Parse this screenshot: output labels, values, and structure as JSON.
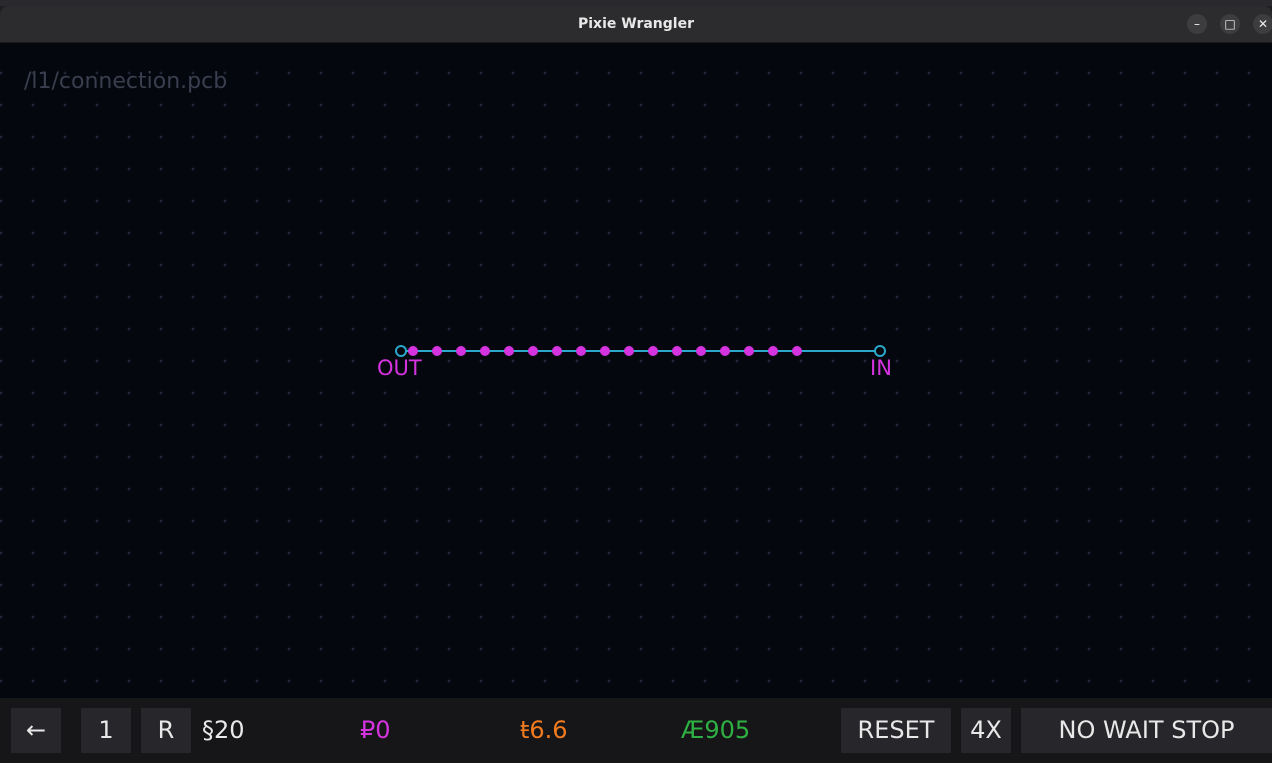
{
  "window": {
    "title": "Pixie Wrangler",
    "minimize_glyph": "–",
    "maximize_glyph": "□",
    "close_glyph": "✕"
  },
  "canvas": {
    "file_path": "/l1/connection.pcb",
    "out_label": "OUT",
    "in_label": "IN",
    "trace_color": "#2aa7c9",
    "pixie_color": "#d633e0",
    "pixie_count": 17
  },
  "toolbar": {
    "back_glyph": "←",
    "level_button": "1",
    "reset_r_button": "R",
    "segments_stat": "§20",
    "pixie_stat": "₽0",
    "time_stat": "ŧ6.6",
    "score_stat": "Æ905",
    "reset_button": "RESET",
    "speed_button": "4X",
    "mode_button": "NO WAIT STOP"
  },
  "colors": {
    "background": "#05070f",
    "pixie_stat": "#d633e0",
    "time_stat": "#f07a1e",
    "score_stat": "#2fb043"
  }
}
